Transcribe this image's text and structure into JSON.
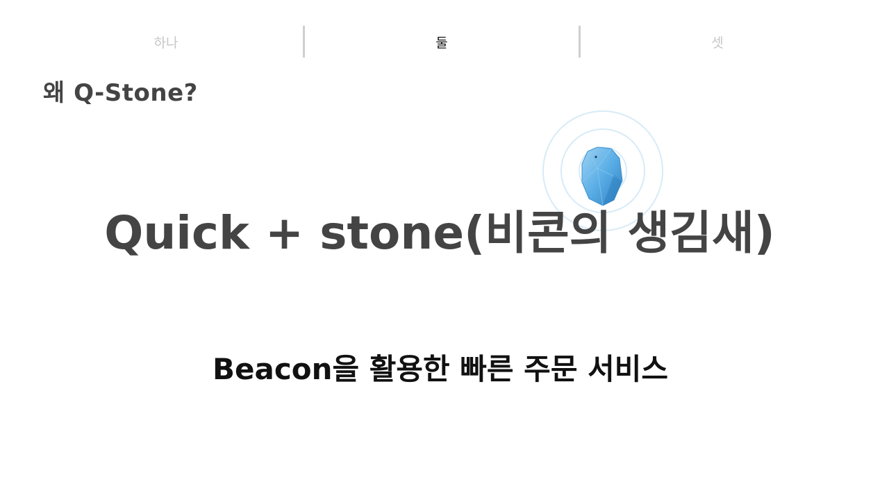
{
  "tabs": [
    {
      "label": "하나",
      "active": false
    },
    {
      "label": "둘",
      "active": true
    },
    {
      "label": "셋",
      "active": false
    }
  ],
  "section_title": "왜 Q-Stone?",
  "headline": "Quick + stone(비콘의 생김새)",
  "subtitle": "Beacon을 활용한 빠른 주문 서비스",
  "colors": {
    "heading": "#444444",
    "active_tab": "#111111",
    "inactive_tab": "#c6c6c6",
    "beacon_blue": "#5aaee6",
    "signal_ring": "#cfe6f4"
  }
}
